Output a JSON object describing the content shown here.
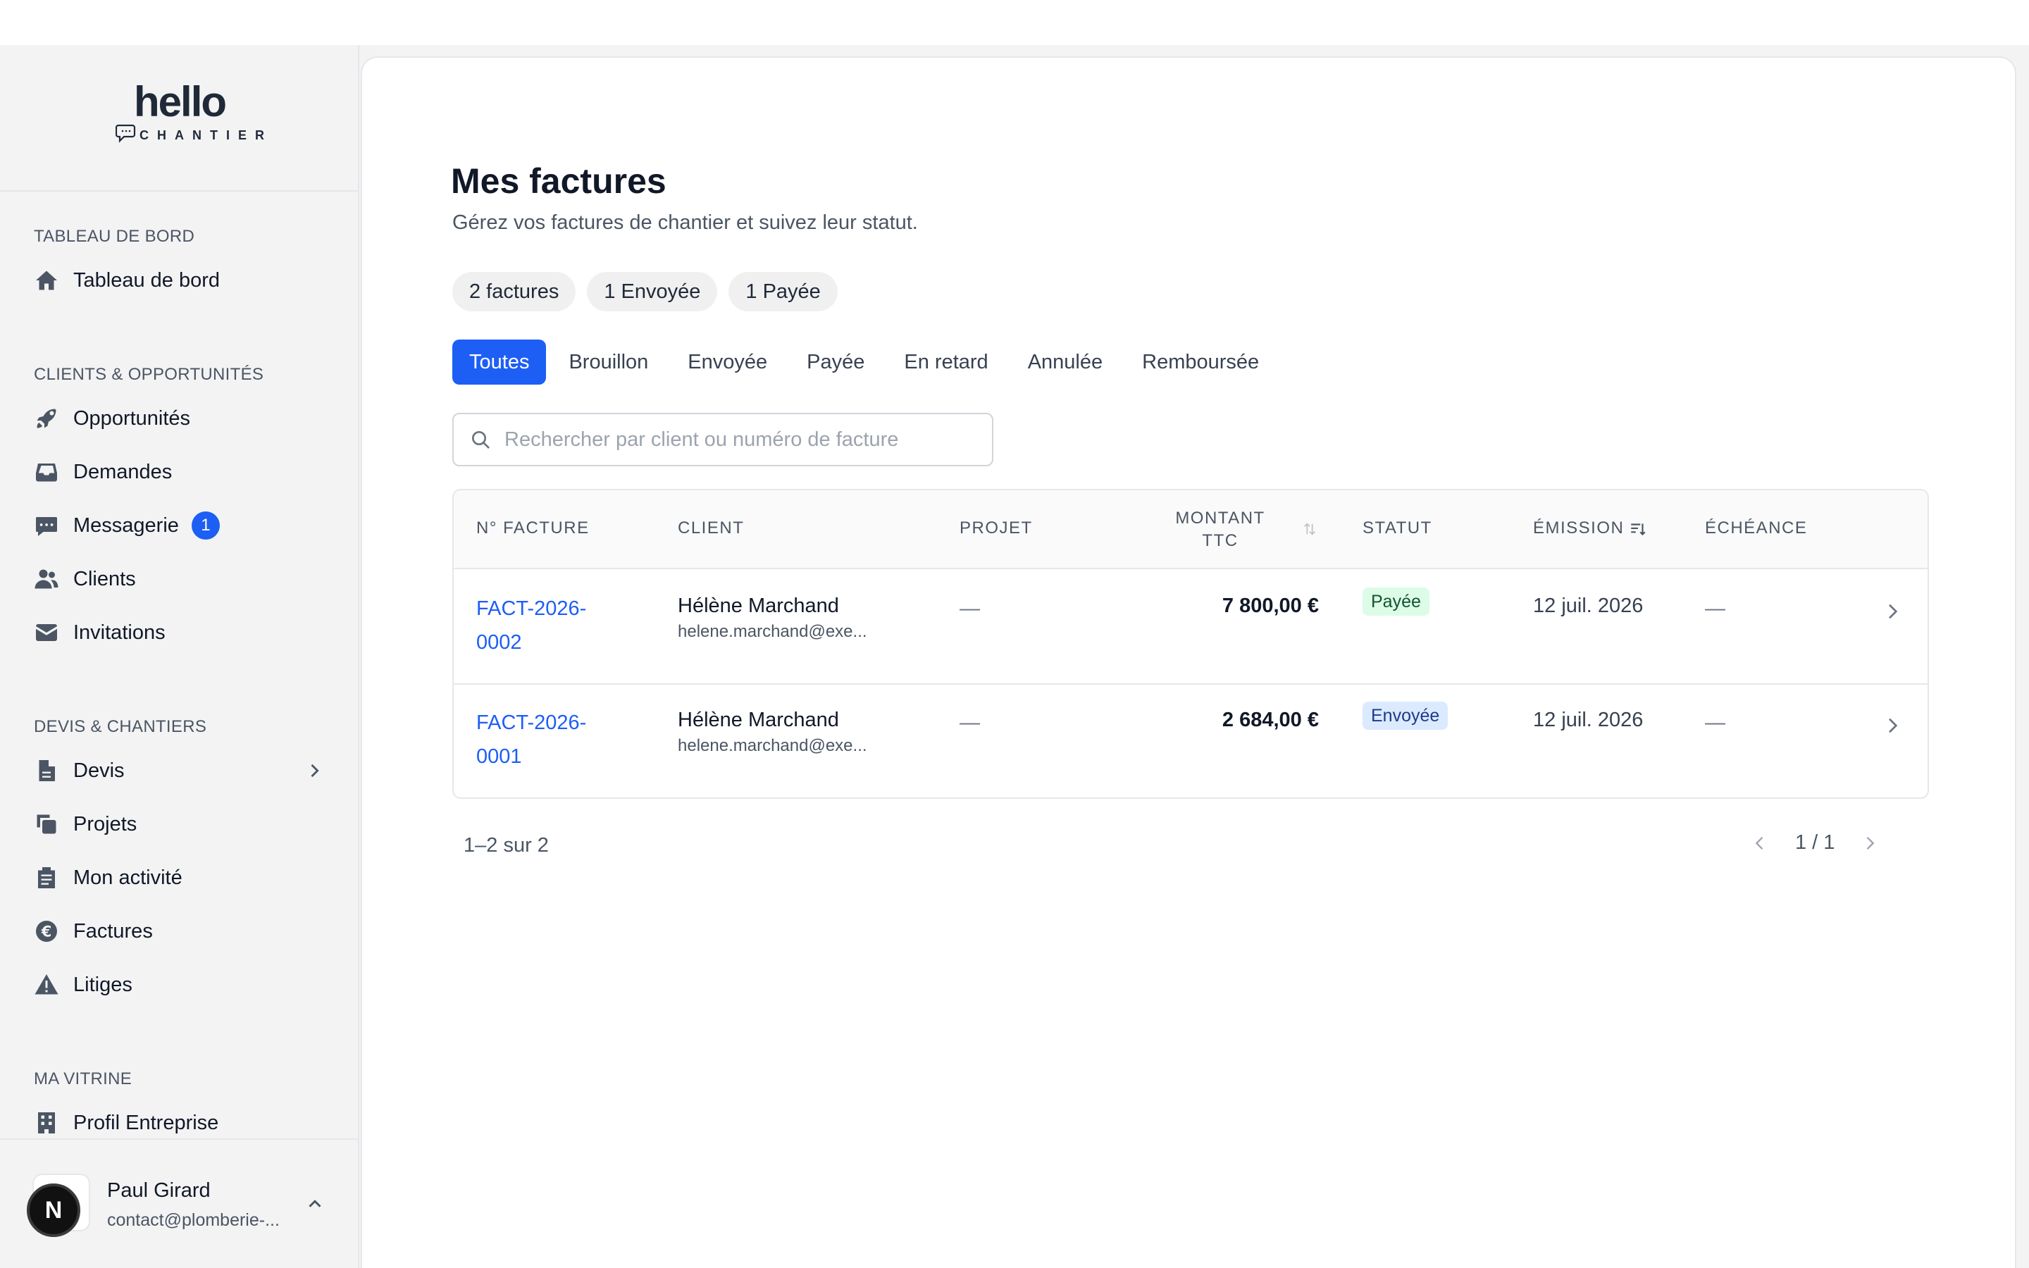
{
  "brand": {
    "logo_main": "hello",
    "logo_sub": "CHANTIER"
  },
  "sidebar": {
    "sections": [
      {
        "title": "TABLEAU DE BORD",
        "items": [
          {
            "label": "Tableau de bord",
            "icon": "home-icon"
          }
        ]
      },
      {
        "title": "CLIENTS & OPPORTUNITÉS",
        "items": [
          {
            "label": "Opportunités",
            "icon": "rocket-icon"
          },
          {
            "label": "Demandes",
            "icon": "inbox-icon"
          },
          {
            "label": "Messagerie",
            "icon": "message-icon",
            "badge": "1"
          },
          {
            "label": "Clients",
            "icon": "users-icon"
          },
          {
            "label": "Invitations",
            "icon": "mail-icon"
          }
        ]
      },
      {
        "title": "DEVIS & CHANTIERS",
        "items": [
          {
            "label": "Devis",
            "icon": "document-icon",
            "has_submenu": true
          },
          {
            "label": "Projets",
            "icon": "copy-icon"
          },
          {
            "label": "Mon activité",
            "icon": "clipboard-icon"
          },
          {
            "label": "Factures",
            "icon": "euro-icon"
          },
          {
            "label": "Litiges",
            "icon": "warning-icon"
          }
        ]
      },
      {
        "title": "MA VITRINE",
        "items": [
          {
            "label": "Profil Entreprise",
            "icon": "building-icon"
          }
        ]
      }
    ],
    "user": {
      "name": "Paul Girard",
      "email": "contact@plomberie-...",
      "avatar_initial": "N"
    }
  },
  "main": {
    "title": "Mes factures",
    "subtitle": "Gérez vos factures de chantier et suivez leur statut.",
    "chips": [
      "2 factures",
      "1 Envoyée",
      "1 Payée"
    ],
    "tabs": [
      {
        "label": "Toutes",
        "active": true
      },
      {
        "label": "Brouillon"
      },
      {
        "label": "Envoyée"
      },
      {
        "label": "Payée"
      },
      {
        "label": "En retard"
      },
      {
        "label": "Annulée"
      },
      {
        "label": "Remboursée"
      }
    ],
    "search": {
      "placeholder": "Rechercher par client ou numéro de facture",
      "value": ""
    },
    "table": {
      "columns": {
        "number": "N° FACTURE",
        "client": "CLIENT",
        "project": "PROJET",
        "amount_line1": "MONTANT",
        "amount_line2": "TTC",
        "status": "STATUT",
        "issue": "ÉMISSION",
        "due": "ÉCHÉANCE"
      },
      "rows": [
        {
          "number_line1": "FACT-2026-",
          "number_line2": "0002",
          "client_name": "Hélène Marchand",
          "client_email": "helene.marchand@exe...",
          "project": "—",
          "amount": "7 800,00 €",
          "status": "Payée",
          "status_color": "#dcfce7",
          "issue_date": "12 juil. 2026",
          "due_date": "—"
        },
        {
          "number_line1": "FACT-2026-",
          "number_line2": "0001",
          "client_name": "Hélène Marchand",
          "client_email": "helene.marchand@exe...",
          "project": "—",
          "amount": "2 684,00 €",
          "status": "Envoyée",
          "status_color": "#dbeafe",
          "issue_date": "12 juil. 2026",
          "due_date": "—"
        }
      ]
    },
    "pagination": {
      "count_text": "1–2 sur 2",
      "page_text": "1 / 1"
    }
  },
  "colors": {
    "accent": "#1d5ef5",
    "sidebar_bg": "#f3f3f4"
  }
}
